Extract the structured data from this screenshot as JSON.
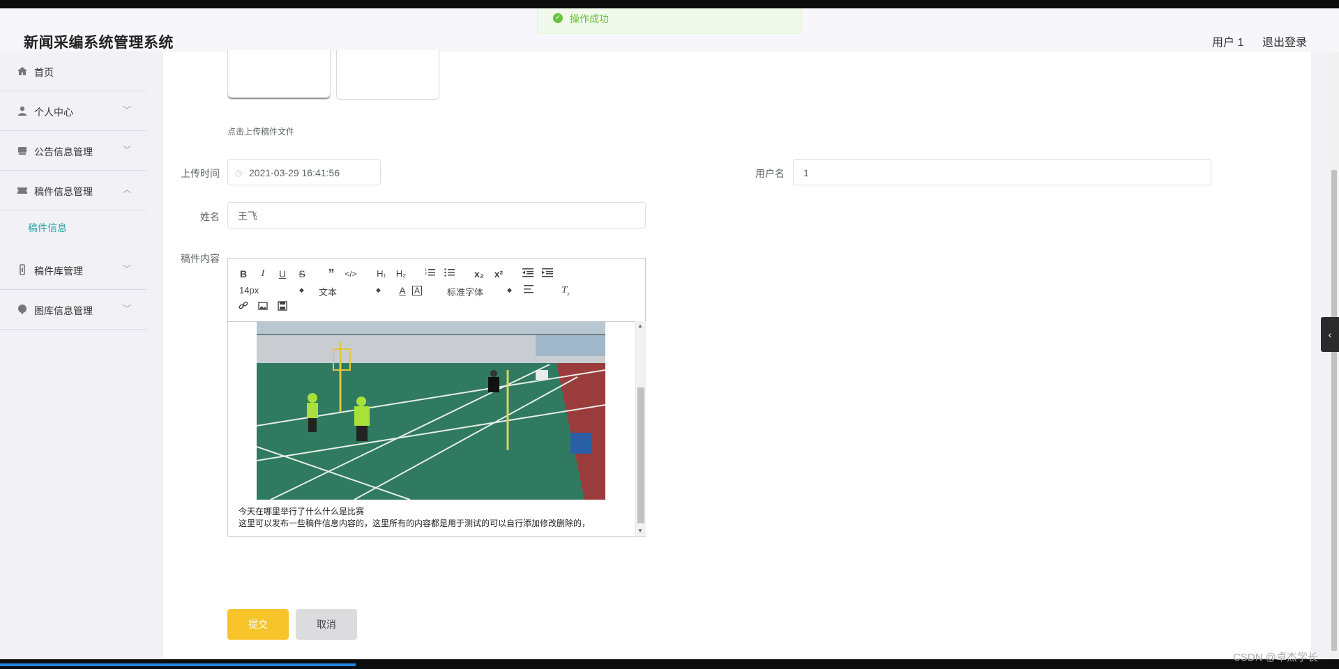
{
  "header": {
    "app_title": "新闻采编系统管理系统",
    "user_label": "用户 1",
    "logout_label": "退出登录"
  },
  "toast": {
    "message": "操作成功",
    "icon": "check-circle-icon",
    "color": "#67c23a"
  },
  "sidebar": {
    "items": [
      {
        "label": "首页",
        "icon": "home-icon"
      },
      {
        "label": "个人中心",
        "icon": "user-icon"
      },
      {
        "label": "公告信息管理",
        "icon": "notice-icon"
      },
      {
        "label": "稿件信息管理",
        "icon": "ticket-icon"
      },
      {
        "label": "稿件库管理",
        "icon": "library-icon"
      },
      {
        "label": "图库信息管理",
        "icon": "gallery-icon"
      }
    ],
    "active_sub_item": "稿件信息",
    "accent_color": "#2ea8a2"
  },
  "form": {
    "upload_tip": "点击上传稿件文件",
    "upload_time_label": "上传时间",
    "upload_time_value": "2021-03-29 16:41:56",
    "username_label": "用户名",
    "username_value": "1",
    "name_label": "姓名",
    "name_value": "王飞",
    "content_label": "稿件内容"
  },
  "editor": {
    "font_size": "14px",
    "header_select": "文本",
    "font_family": "标准字体",
    "content_lines": [
      "今天在哪里举行了什么什么是比赛",
      "这里可以发布一些稿件信息内容的，这里所有的内容都是用于测试的可以自行添加修改删除的，"
    ]
  },
  "actions": {
    "submit_label": "提交",
    "cancel_label": "取消",
    "submit_color": "#f8c42c"
  },
  "watermark": "CSDN @卓杰学长"
}
